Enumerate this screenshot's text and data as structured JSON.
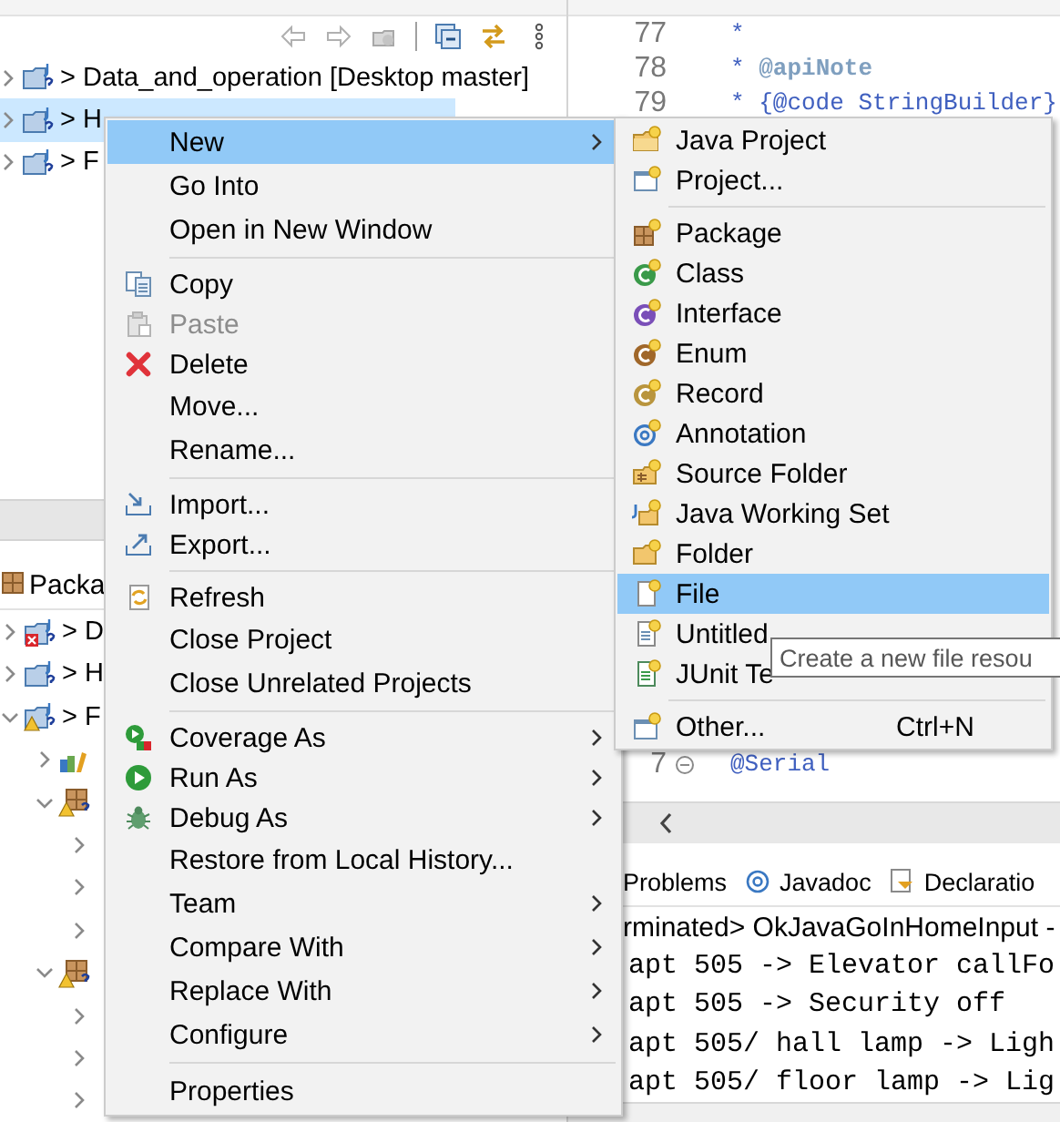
{
  "navigator": {
    "items": [
      {
        "label": "> Data_and_operation [Desktop master]",
        "selected": false,
        "expanded": false
      },
      {
        "label": "> H",
        "selected": true,
        "expanded": false
      },
      {
        "label": "> F",
        "selected": false,
        "expanded": false
      }
    ]
  },
  "package_explorer": {
    "tab": "Packa",
    "items": [
      {
        "kind": "project",
        "label": "> D",
        "error": true,
        "warning": false,
        "expanded": false
      },
      {
        "kind": "project",
        "label": "> H",
        "error": false,
        "warning": false,
        "expanded": false
      },
      {
        "kind": "project",
        "label": "> F",
        "error": false,
        "warning": true,
        "expanded": true,
        "children": [
          {
            "kind": "library",
            "expanded": false
          },
          {
            "kind": "package",
            "error": false,
            "warning": true,
            "expanded": true,
            "children": [
              {
                "expanded": false
              },
              {
                "expanded": false
              },
              {
                "expanded": false
              }
            ]
          },
          {
            "kind": "package",
            "error": false,
            "warning": true,
            "expanded": true,
            "children": [
              {
                "expanded": false
              },
              {
                "expanded": false
              },
              {
                "expanded": false
              }
            ]
          }
        ]
      }
    ]
  },
  "editor": {
    "lines_top": [
      {
        "number": "77",
        "code": "*"
      },
      {
        "number": "78",
        "code": "* **@apiNote**"
      },
      {
        "number": "79",
        "code": "* {@code StringBuilder}"
      }
    ],
    "lines_bottom": [
      {
        "number": "7",
        "code": "@Serial",
        "folded": false
      }
    ]
  },
  "console": {
    "tabs": [
      {
        "label": "Problems"
      },
      {
        "label": "Javadoc"
      },
      {
        "label": "Declaratio"
      }
    ],
    "header": "rminated> OkJavaGoInHomeInput -",
    "lines": [
      "apt 505 -> Elevator callFo",
      "apt 505 -> Security off",
      "apt 505/ hall lamp -> Ligh",
      "apt 505/ floor lamp -> Lig"
    ]
  },
  "context_menu": {
    "groups": [
      {
        "items": [
          {
            "label": "New",
            "submenu": true,
            "selected": true,
            "disabled": false
          },
          {
            "label": "Go Into",
            "submenu": false,
            "selected": false,
            "disabled": false
          },
          {
            "label": "Open in New Window",
            "submenu": false,
            "selected": false,
            "disabled": false
          }
        ]
      },
      {
        "items": [
          {
            "label": "Copy",
            "submenu": false,
            "selected": false,
            "disabled": false
          },
          {
            "label": "Paste",
            "submenu": false,
            "selected": false,
            "disabled": true
          },
          {
            "label": "Delete",
            "submenu": false,
            "selected": false,
            "disabled": false
          },
          {
            "label": "Move...",
            "submenu": false,
            "selected": false,
            "disabled": false
          },
          {
            "label": "Rename...",
            "submenu": false,
            "selected": false,
            "disabled": false
          }
        ]
      },
      {
        "items": [
          {
            "label": "Import...",
            "submenu": false,
            "selected": false,
            "disabled": false
          },
          {
            "label": "Export...",
            "submenu": false,
            "selected": false,
            "disabled": false
          }
        ]
      },
      {
        "items": [
          {
            "label": "Refresh",
            "submenu": false,
            "selected": false,
            "disabled": false
          },
          {
            "label": "Close Project",
            "submenu": false,
            "selected": false,
            "disabled": false
          },
          {
            "label": "Close Unrelated Projects",
            "submenu": false,
            "selected": false,
            "disabled": false
          }
        ]
      },
      {
        "items": [
          {
            "label": "Coverage As",
            "submenu": true,
            "selected": false,
            "disabled": false
          },
          {
            "label": "Run As",
            "submenu": true,
            "selected": false,
            "disabled": false
          },
          {
            "label": "Debug As",
            "submenu": true,
            "selected": false,
            "disabled": false
          },
          {
            "label": "Restore from Local History...",
            "submenu": false,
            "selected": false,
            "disabled": false
          },
          {
            "label": "Team",
            "submenu": true,
            "selected": false,
            "disabled": false
          },
          {
            "label": "Compare With",
            "submenu": true,
            "selected": false,
            "disabled": false
          },
          {
            "label": "Replace With",
            "submenu": true,
            "selected": false,
            "disabled": false
          },
          {
            "label": "Configure",
            "submenu": true,
            "selected": false,
            "disabled": false
          }
        ]
      },
      {
        "items": [
          {
            "label": "Properties",
            "submenu": false,
            "selected": false,
            "disabled": false
          }
        ]
      }
    ]
  },
  "new_submenu": {
    "groups": [
      {
        "items": [
          {
            "label": "Java Project",
            "selected": false
          },
          {
            "label": "Project...",
            "selected": false
          }
        ]
      },
      {
        "items": [
          {
            "label": "Package",
            "selected": false
          },
          {
            "label": "Class",
            "selected": false
          },
          {
            "label": "Interface",
            "selected": false
          },
          {
            "label": "Enum",
            "selected": false
          },
          {
            "label": "Record",
            "selected": false
          },
          {
            "label": "Annotation",
            "selected": false
          },
          {
            "label": "Source Folder",
            "selected": false
          },
          {
            "label": "Java Working Set",
            "selected": false
          },
          {
            "label": "Folder",
            "selected": false
          },
          {
            "label": "File",
            "selected": true
          },
          {
            "label": "Untitled",
            "selected": false
          },
          {
            "label": "JUnit Te",
            "selected": false
          }
        ]
      },
      {
        "items": [
          {
            "label": "Other...",
            "shortcut": "Ctrl+N",
            "selected": false
          }
        ]
      }
    ]
  },
  "tooltip": {
    "text": "Create a new file resou"
  }
}
